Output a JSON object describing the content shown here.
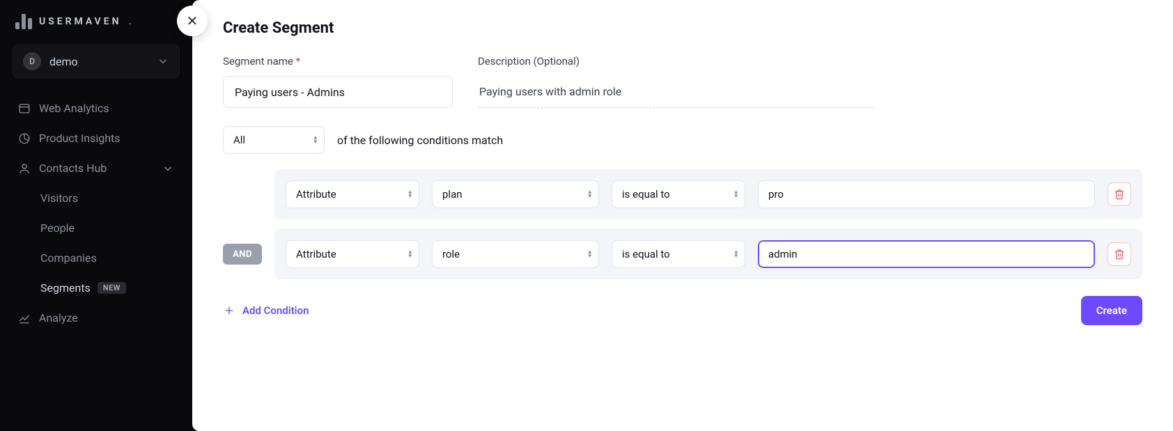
{
  "brand": {
    "name": "USERMAVEN"
  },
  "workspace": {
    "initial": "D",
    "name": "demo"
  },
  "nav": {
    "web_analytics": "Web Analytics",
    "product_insights": "Product Insights",
    "contacts_hub": "Contacts Hub",
    "analyze": "Analyze",
    "sub": {
      "visitors": "Visitors",
      "people": "People",
      "companies": "Companies",
      "segments": "Segments",
      "segments_badge": "NEW"
    }
  },
  "panel": {
    "title": "Create Segment",
    "segment_name_label": "Segment name",
    "segment_name_value": "Paying users - Admins",
    "description_label": "Description (Optional)",
    "description_value": "Paying users with admin role",
    "match_select": "All",
    "match_text": "of the following conditions match",
    "and_label": "AND",
    "add_condition": "Add Condition",
    "create_button": "Create",
    "conditions": [
      {
        "type": "Attribute",
        "field": "plan",
        "operator": "is equal to",
        "value": "pro",
        "focused": false,
        "show_and": false
      },
      {
        "type": "Attribute",
        "field": "role",
        "operator": "is equal to",
        "value": "admin",
        "focused": true,
        "show_and": true
      }
    ]
  }
}
